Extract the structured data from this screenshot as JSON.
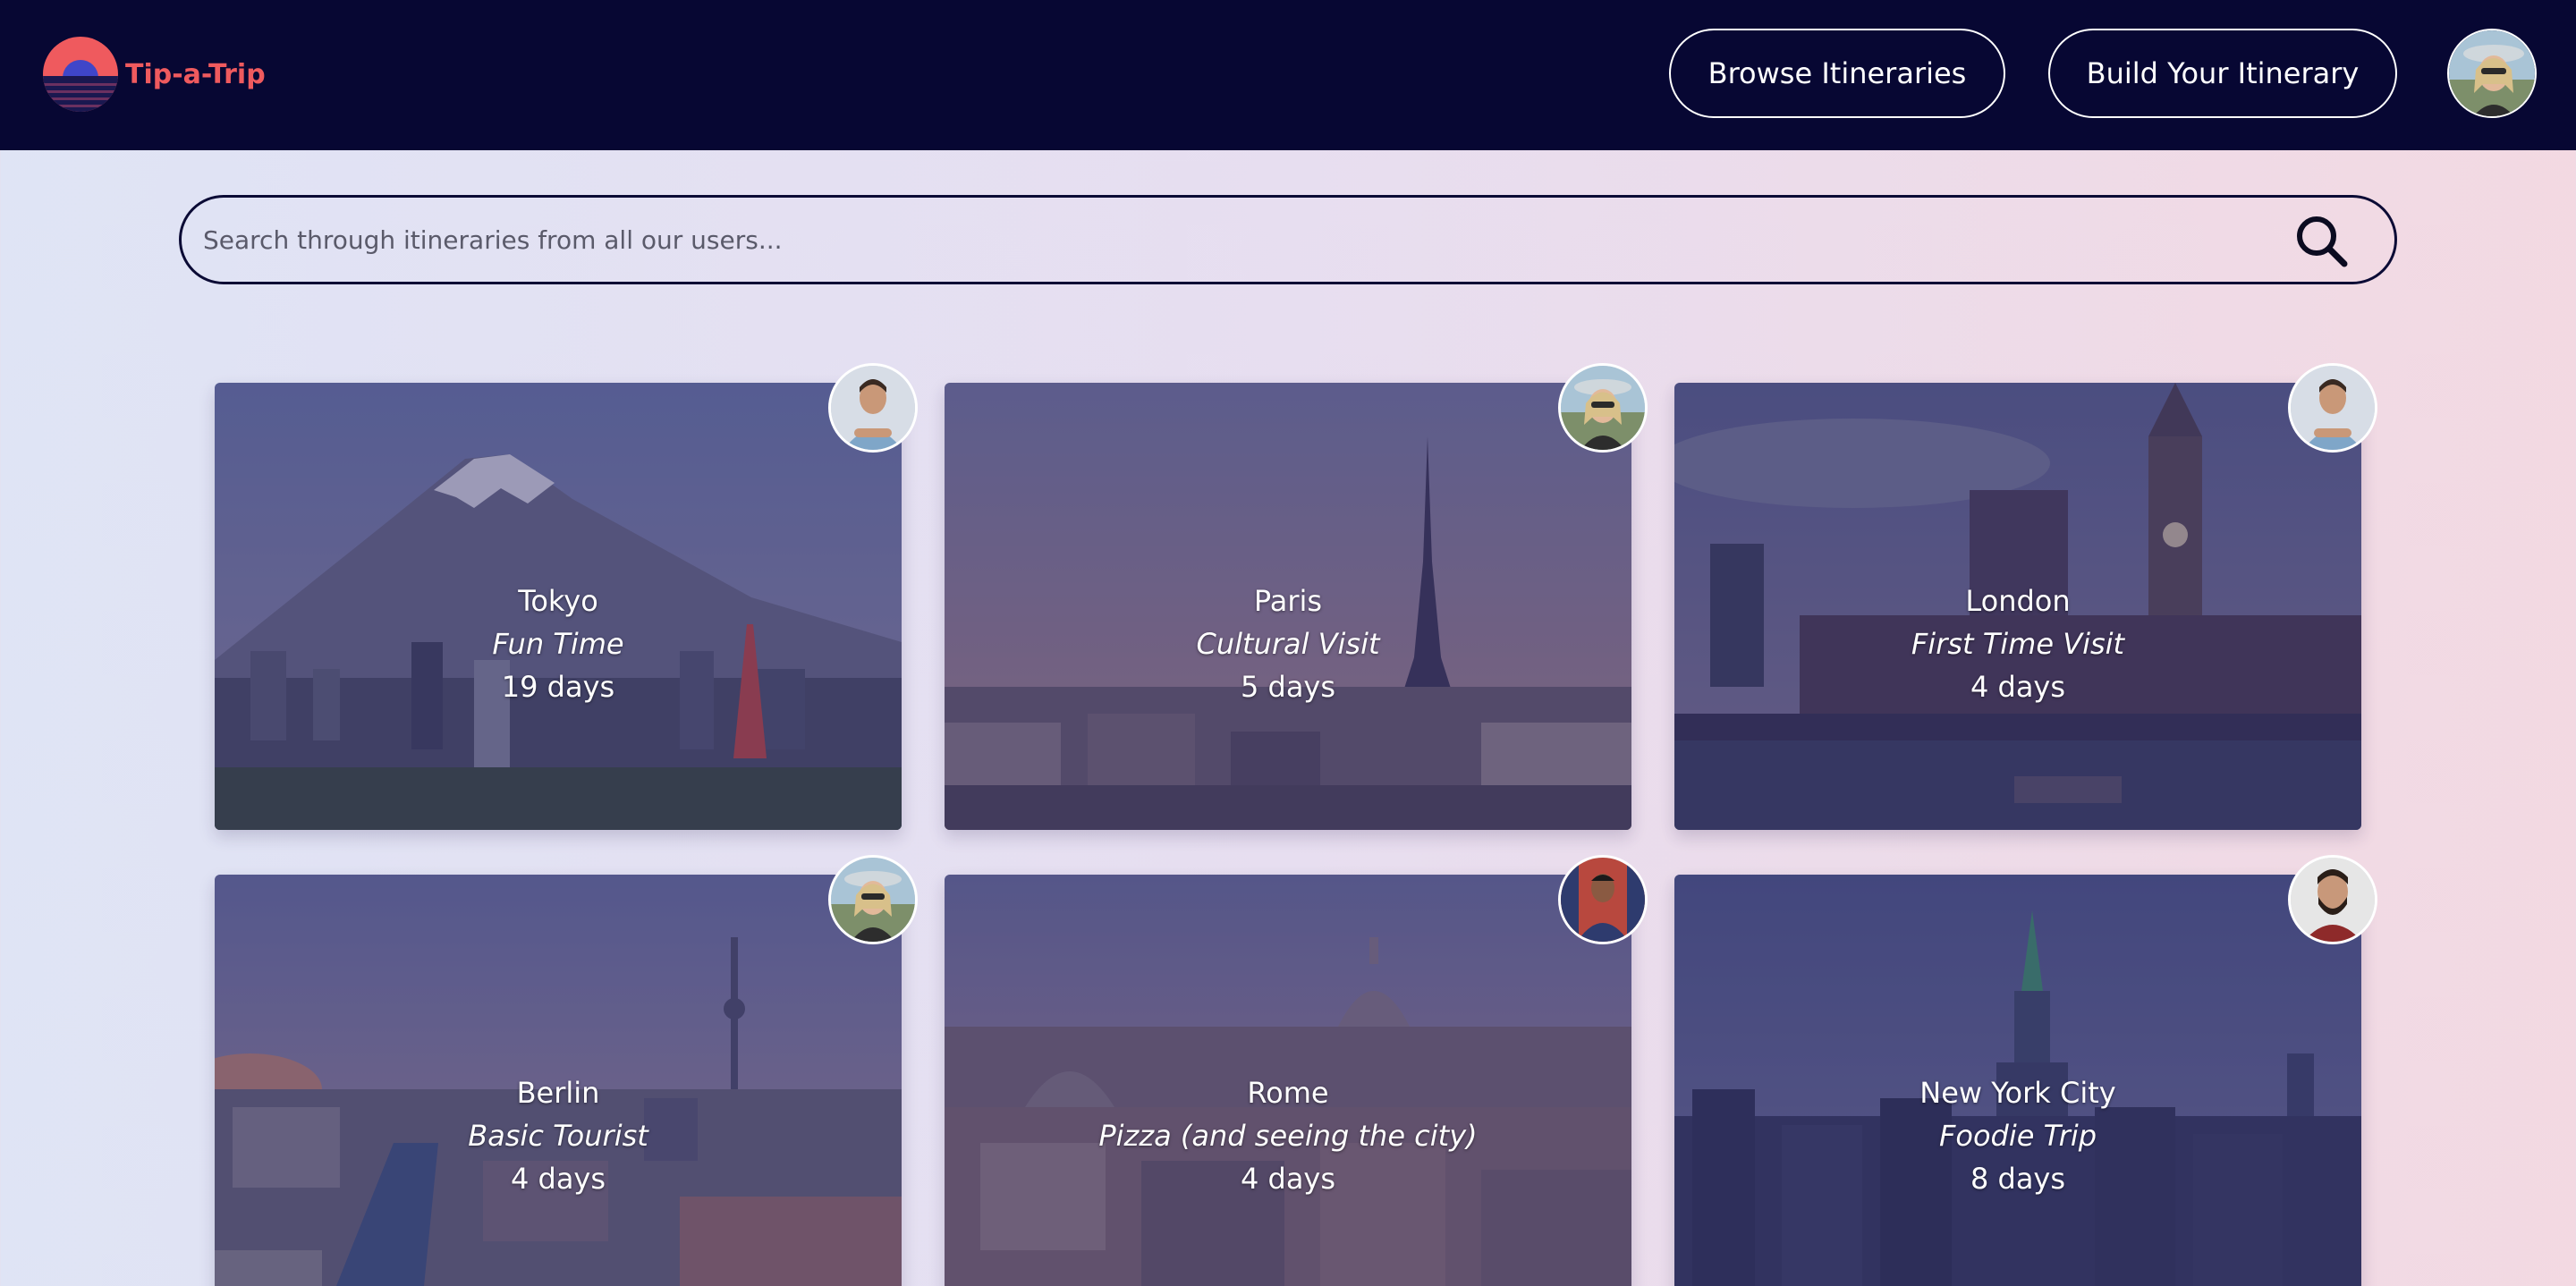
{
  "header": {
    "logo_text": "Tip-a-Trip",
    "browse_label": "Browse Itineraries",
    "build_label": "Build Your Itinerary"
  },
  "search": {
    "placeholder": "Search through itineraries from all our users..."
  },
  "colors": {
    "navbar": "#070733",
    "logo_red": "#ef5a5e",
    "page_gradient_start": "#dfe4f5",
    "page_gradient_end": "#f3d9e2"
  },
  "itineraries": [
    {
      "city": "Tokyo",
      "trip_name": "Fun Time",
      "duration": "19 days",
      "scene": "mountain-tower",
      "owner_avatar": "man-blue-shirt"
    },
    {
      "city": "Paris",
      "trip_name": "Cultural Visit",
      "duration": "5 days",
      "scene": "eiffel-tower",
      "owner_avatar": "woman-sunglasses"
    },
    {
      "city": "London",
      "trip_name": "First Time Visit",
      "duration": "4 days",
      "scene": "big-ben",
      "owner_avatar": "man-blue-shirt"
    },
    {
      "city": "Berlin",
      "trip_name": "Basic Tourist",
      "duration": "4 days",
      "scene": "tv-tower",
      "owner_avatar": "woman-sunglasses"
    },
    {
      "city": "Rome",
      "trip_name": "Pizza (and seeing the city)",
      "duration": "4 days",
      "scene": "domes",
      "owner_avatar": "man-dark-jacket"
    },
    {
      "city": "New York City",
      "trip_name": "Foodie Trip",
      "duration": "8 days",
      "scene": "skyscrapers",
      "owner_avatar": "man-beard-red-shirt"
    }
  ]
}
